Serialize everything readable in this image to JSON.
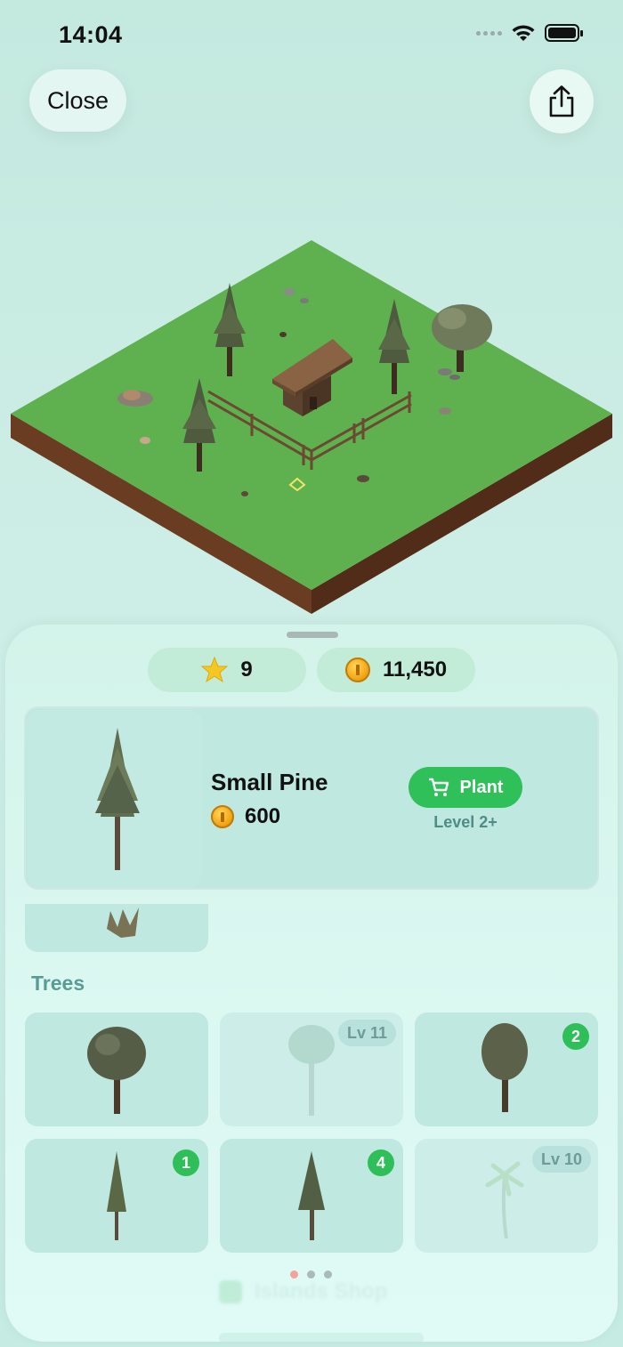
{
  "status_bar": {
    "time": "14:04"
  },
  "header": {
    "close_label": "Close"
  },
  "currency": {
    "stars": "9",
    "coins": "11,450"
  },
  "featured": {
    "name": "Small Pine",
    "price": "600",
    "plant_label": "Plant",
    "level_requirement": "Level 2+"
  },
  "section": {
    "title": "Trees"
  },
  "trees": [
    {
      "name": "oak",
      "badge": ""
    },
    {
      "name": "birch",
      "badge": "Lv 11",
      "locked": true
    },
    {
      "name": "round-tree",
      "badge": "2"
    },
    {
      "name": "small-pine",
      "badge": "1"
    },
    {
      "name": "pine",
      "badge": "4"
    },
    {
      "name": "palm",
      "badge": "Lv 10",
      "locked": true
    }
  ],
  "footer": {
    "faded_label": "Islands Shop"
  },
  "colors": {
    "accent_green": "#30c05a",
    "background": "#c6ebe3",
    "card": "#bfe8e1",
    "grass": "#5fb04e",
    "soil": "#5b3320"
  }
}
